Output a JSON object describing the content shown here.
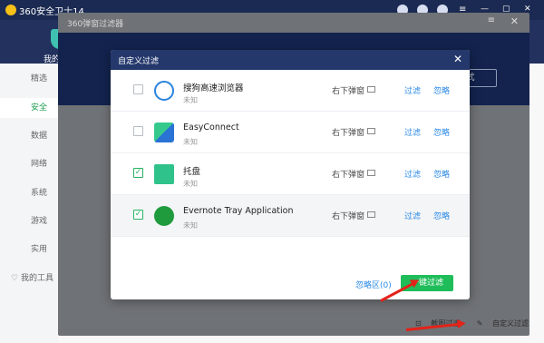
{
  "app": {
    "title": "360安全卫士14",
    "my": "我的"
  },
  "sidebar": {
    "items": [
      {
        "label": "精选"
      },
      {
        "label": "安全"
      },
      {
        "label": "数据"
      },
      {
        "label": "网络"
      },
      {
        "label": "系统"
      },
      {
        "label": "游戏"
      },
      {
        "label": "实用"
      }
    ],
    "tools": "我的工具"
  },
  "outer": {
    "title": "360弹窗过滤器",
    "banner_btn": "式",
    "screenshot_filter": "截图过滤",
    "custom_filter": "自定义过滤"
  },
  "dialog": {
    "title": "自定义过滤",
    "ignored_link": "忽略区(0)",
    "onekey": "一键过滤",
    "rows": [
      {
        "name": "搜狗高速浏览器",
        "sub": "未知",
        "position": "右下弹窗",
        "filter": "过滤",
        "ignore": "忽略",
        "checked": false
      },
      {
        "name": "EasyConnect",
        "sub": "未知",
        "position": "右下弹窗",
        "filter": "过滤",
        "ignore": "忽略",
        "checked": false
      },
      {
        "name": "托盘",
        "sub": "未知",
        "position": "右下弹窗",
        "filter": "过滤",
        "ignore": "忽略",
        "checked": true
      },
      {
        "name": "Evernote Tray Application",
        "sub": "未知",
        "position": "右下弹窗",
        "filter": "过滤",
        "ignore": "忽略",
        "checked": true
      }
    ]
  },
  "colors": {
    "accent_green": "#1fbd5a",
    "link_blue": "#2b8ae6",
    "title_navy": "#24386c",
    "annotation_red": "#e32219"
  }
}
